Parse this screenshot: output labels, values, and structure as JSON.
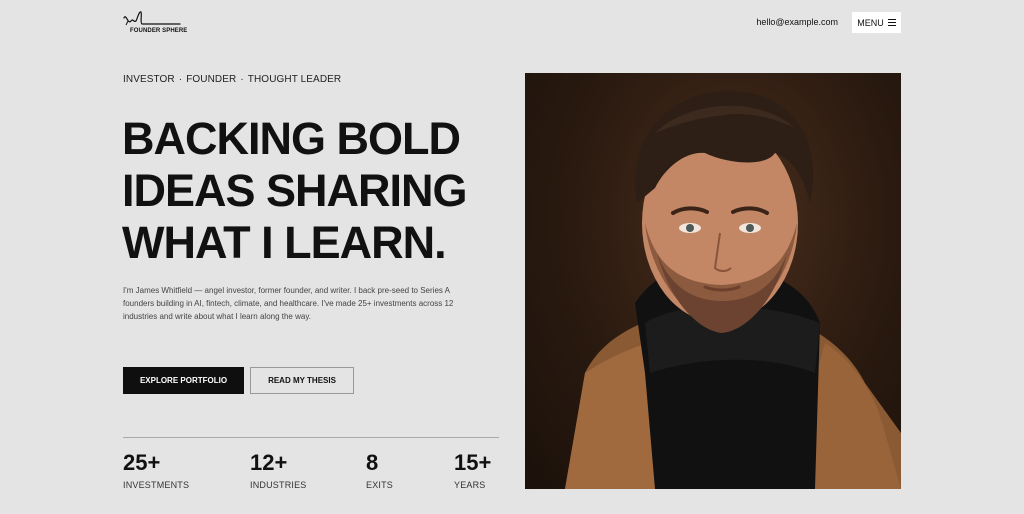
{
  "header": {
    "logo_text": "FOUNDER SPHERE",
    "email": "hello@example.com",
    "menu_label": "MENU"
  },
  "hero": {
    "tagline": [
      "INVESTOR",
      "FOUNDER",
      "THOUGHT LEADER"
    ],
    "headline_lines": [
      "BACKING BOLD",
      "IDEAS SHARING",
      "WHAT I LEARN."
    ],
    "bio": "I'm James Whitfield — angel investor, former founder, and writer. I back pre-seed to Series A founders building in AI, fintech, climate, and healthcare. I've made 25+ investments across 12 industries and write about what I learn along the way.",
    "primary_button": "EXPLORE PORTFOLIO",
    "secondary_button": "READ MY THESIS"
  },
  "stats": [
    {
      "value": "25+",
      "label": "INVESTMENTS"
    },
    {
      "value": "12+",
      "label": "INDUSTRIES"
    },
    {
      "value": "8",
      "label": "EXITS"
    },
    {
      "value": "15+",
      "label": "YEARS"
    }
  ]
}
